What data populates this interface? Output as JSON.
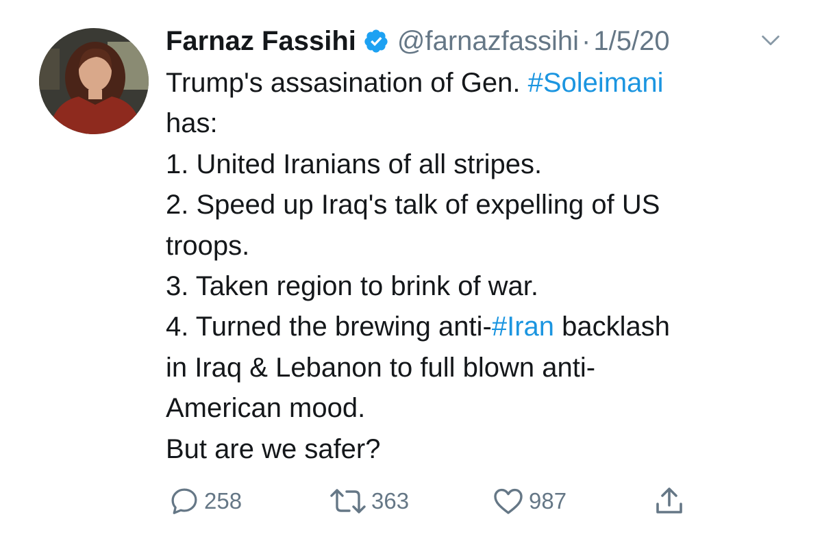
{
  "author": {
    "display_name": "Farnaz Fassihi",
    "handle": "@farnazfassihi",
    "separator": "·",
    "date": "1/5/20",
    "verified": true
  },
  "tweet": {
    "lines": [
      [
        {
          "text": "Trump's assasination of Gen. "
        },
        {
          "text": "#Soleimani",
          "hashtag": true
        }
      ],
      [
        {
          "text": "has:"
        }
      ],
      [
        {
          "text": "1. United Iranians of all stripes."
        }
      ],
      [
        {
          "text": "2. Speed up Iraq's talk of expelling of US"
        }
      ],
      [
        {
          "text": "troops."
        }
      ],
      [
        {
          "text": "3. Taken region to brink of war."
        }
      ],
      [
        {
          "text": "4. Turned the brewing anti-"
        },
        {
          "text": "#Iran",
          "hashtag": true
        },
        {
          "text": " backlash"
        }
      ],
      [
        {
          "text": "in Iraq & Lebanon to full blown anti-"
        }
      ],
      [
        {
          "text": "American mood."
        }
      ],
      [
        {
          "text": "But are we safer?"
        }
      ]
    ]
  },
  "actions": {
    "replies": "258",
    "retweets": "363",
    "likes": "987"
  },
  "icons": {
    "reply": "reply-icon",
    "retweet": "retweet-icon",
    "like": "heart-icon",
    "share": "share-icon",
    "verified": "verified-badge-icon",
    "menu": "chevron-down-icon"
  },
  "colors": {
    "text": "#14171a",
    "secondary": "#657786",
    "link": "#1b95e0",
    "verified": "#1da1f2"
  }
}
